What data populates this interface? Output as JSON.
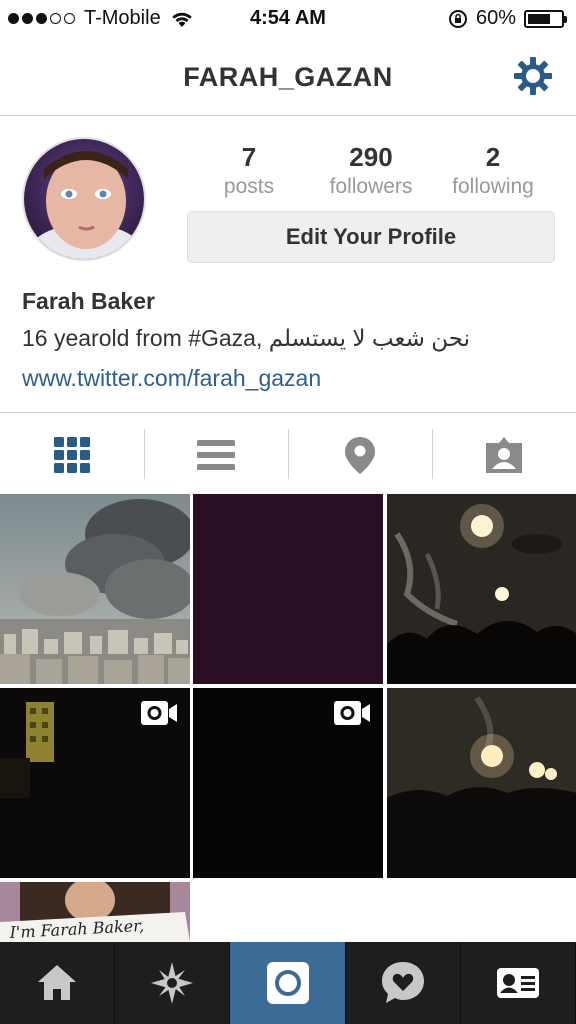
{
  "status_bar": {
    "carrier": "T-Mobile",
    "time": "4:54 AM",
    "battery_percent": "60%",
    "signal_bars_filled": 3,
    "signal_bars_total": 5
  },
  "nav": {
    "title": "FARAH_GAZAN",
    "settings_icon": "gear-icon"
  },
  "profile": {
    "stats": [
      {
        "value": "7",
        "label": "posts"
      },
      {
        "value": "290",
        "label": "followers"
      },
      {
        "value": "2",
        "label": "following"
      }
    ],
    "edit_button_label": "Edit Your Profile",
    "name": "Farah Baker",
    "bio": "16 yearold from #Gaza, نحن شعب لا يستسلم",
    "website": "www.twitter.com/farah_gazan"
  },
  "view_tabs": [
    {
      "icon": "grid-icon",
      "active": true
    },
    {
      "icon": "list-icon",
      "active": false
    },
    {
      "icon": "location-pin-icon",
      "active": false
    },
    {
      "icon": "tagged-person-icon",
      "active": false
    }
  ],
  "photo_sign_text": "I'm Farah Baker,",
  "bottom_nav": [
    {
      "icon": "home-icon",
      "active": false
    },
    {
      "icon": "explore-icon",
      "active": false
    },
    {
      "icon": "camera-icon",
      "active": true
    },
    {
      "icon": "activity-icon",
      "active": false
    },
    {
      "icon": "profile-card-icon",
      "active": false
    }
  ],
  "colors": {
    "accent": "#3c6b95",
    "link": "#2d5f8e",
    "tab_active": "#2b5a86",
    "tab_inactive": "#8a8a8a",
    "bottom_bar": "#1e1e1e"
  }
}
